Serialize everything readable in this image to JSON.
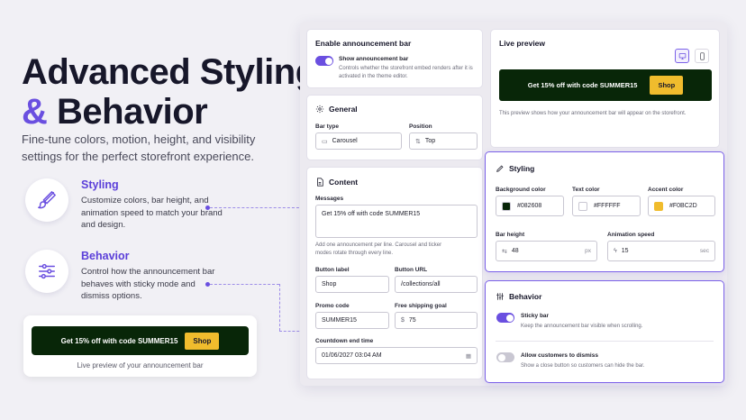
{
  "hero": {
    "title_line1": "Advanced Styling",
    "title_amp": "&",
    "title_line2": "Behavior",
    "subtitle": "Fine-tune colors, motion, height, and visibility settings for the perfect storefront experience."
  },
  "features": [
    {
      "title": "Styling",
      "description": "Customize colors, bar height, and animation speed to match your brand and design.",
      "icon": "paintbrush-icon"
    },
    {
      "title": "Behavior",
      "description": "Control how the announcement bar behaves with sticky mode and dismiss options.",
      "icon": "sliders-icon"
    }
  ],
  "mini_preview": {
    "message": "Get 15% off with code SUMMER15",
    "button": "Shop",
    "caption": "Live preview of your announcement bar"
  },
  "enable_card": {
    "title": "Enable announcement bar",
    "toggle_label": "Show announcement bar",
    "toggle_help": "Controls whether the storefront embed renders after it is activated in the theme editor.",
    "toggle_on": true
  },
  "general": {
    "title": "General",
    "bar_type_label": "Bar type",
    "bar_type_value": "Carousel",
    "position_label": "Position",
    "position_value": "Top"
  },
  "content": {
    "title": "Content",
    "messages_label": "Messages",
    "messages_value": "Get 15% off with code SUMMER15",
    "messages_help": "Add one announcement per line. Carousel and ticker modes rotate through every line.",
    "button_label_label": "Button label",
    "button_label_value": "Shop",
    "button_url_label": "Button URL",
    "button_url_value": "/collections/all",
    "promo_label": "Promo code",
    "promo_value": "SUMMER15",
    "shipping_label": "Free shipping goal",
    "shipping_prefix": "$",
    "shipping_value": "75",
    "countdown_label": "Countdown end time",
    "countdown_value": "01/06/2027 03:04 AM"
  },
  "live_preview": {
    "title": "Live preview",
    "message": "Get 15% off with code SUMMER15",
    "button": "Shop",
    "help": "This preview shows how your announcement bar will appear on the storefront."
  },
  "styling": {
    "title": "Styling",
    "bg_label": "Background color",
    "bg_value": "#082608",
    "text_label": "Text color",
    "text_value": "#FFFFFF",
    "accent_label": "Accent color",
    "accent_value": "#F0BC2D",
    "height_label": "Bar height",
    "height_value": "48",
    "height_unit": "px",
    "speed_label": "Animation speed",
    "speed_value": "15",
    "speed_unit": "sec"
  },
  "behavior": {
    "title": "Behavior",
    "sticky_label": "Sticky bar",
    "sticky_help": "Keep the announcement bar visible when scrolling.",
    "sticky_on": true,
    "dismiss_label": "Allow customers to dismiss",
    "dismiss_help": "Show a close button so customers can hide the bar.",
    "dismiss_on": false
  },
  "colors": {
    "accent": "#6A4FE0",
    "bar_bg": "#082608",
    "bar_button": "#F0BC2D"
  }
}
